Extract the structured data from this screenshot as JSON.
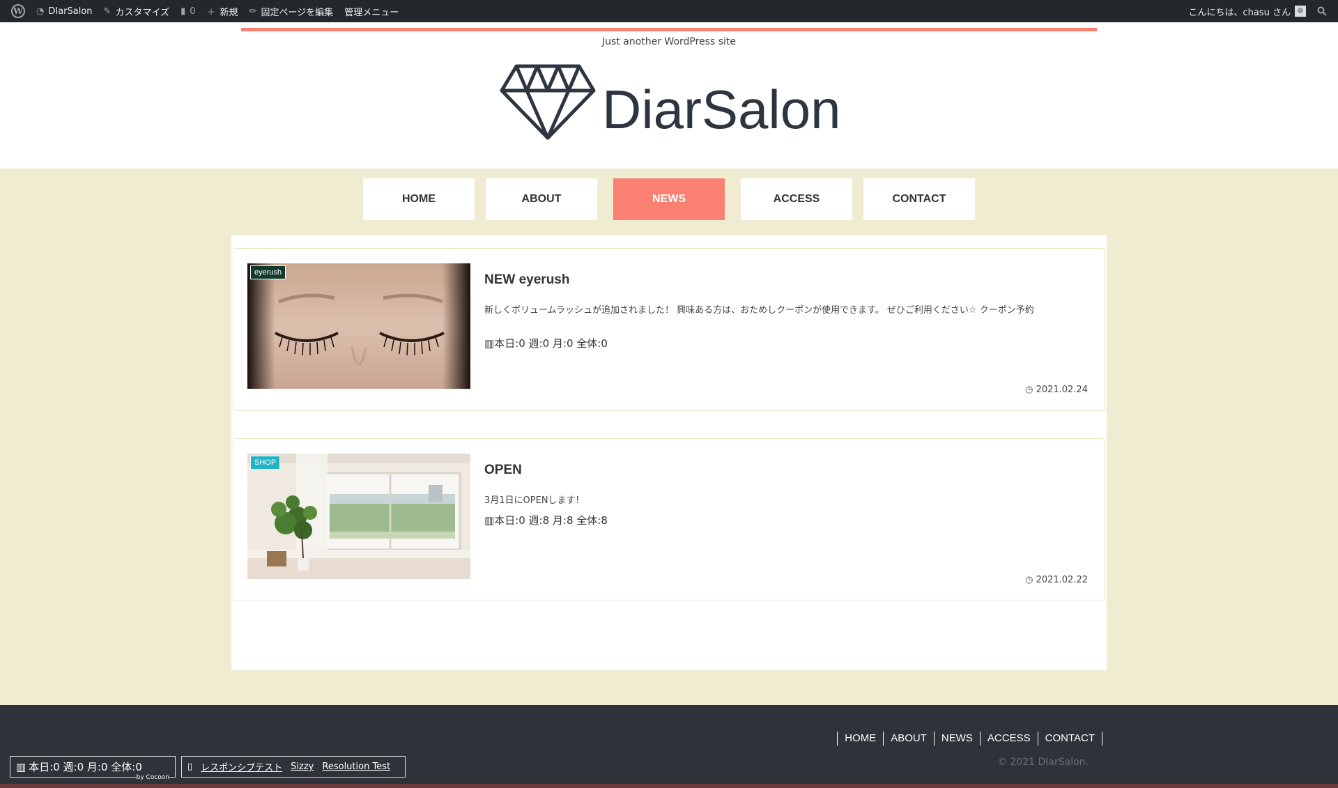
{
  "adminbar": {
    "site_name": "DIarSalon",
    "customize": "カスタマイズ",
    "comments_count": "0",
    "new": "新規",
    "edit_page": "固定ページを編集",
    "admin_menu": "管理メニュー",
    "greeting": "こんにちは、chasu さん"
  },
  "header": {
    "tagline": "Just another WordPress site",
    "logo_text": "DiarSalon"
  },
  "nav": {
    "items": [
      {
        "label": "HOME"
      },
      {
        "label": "ABOUT"
      },
      {
        "label": "NEWS",
        "active": true
      },
      {
        "label": "ACCESS"
      },
      {
        "label": "CONTACT"
      }
    ]
  },
  "posts": [
    {
      "category": "eyerush",
      "category_color": "#123a2c",
      "title": "NEW eyerush",
      "snippet": "新しくボリュームラッシュが追加されました！ 興味ある方は、おためしクーポンが使用できます。 ぜひご利用ください☆ クーポン予約",
      "stats": "本日:0 週:0 月:0 全体:0",
      "date": "2021.02.24"
    },
    {
      "category": "SHOP",
      "category_color": "#1fb4c4",
      "title": "OPEN",
      "snippet": "3月1日にOPENします！",
      "stats": "本日:0 週:8 月:8 全体:8",
      "date": "2021.02.22"
    }
  ],
  "footer": {
    "nav": [
      "HOME",
      "ABOUT",
      "NEWS",
      "ACCESS",
      "CONTACT"
    ],
    "copyright": "© 2021 DIarSalon."
  },
  "debug": {
    "stats": "本日:0 週:0 月:0 全体:0",
    "by": "by Cocoon",
    "links": [
      "レスポンシブテスト",
      "Sizzy",
      "Resolution Test"
    ]
  },
  "colors": {
    "accent": "#fa8072",
    "page_bg": "#f0ecd2",
    "footer_bg": "#2d3339",
    "admin_bg": "#23282d"
  }
}
